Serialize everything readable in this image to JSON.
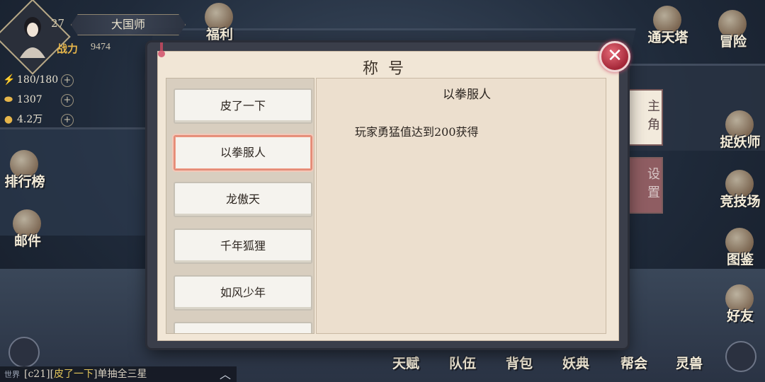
{
  "player": {
    "level": "27",
    "title": "大国师",
    "power_label": "战力",
    "power_value": "9474"
  },
  "stats": [
    {
      "icon": "lightning-icon",
      "value": "180/180"
    },
    {
      "icon": "ingot-icon",
      "value": "1307"
    },
    {
      "icon": "coin-icon",
      "value": "4.2万"
    }
  ],
  "top_icons": [
    "福利",
    "通天塔",
    "冒险"
  ],
  "left_icons": [
    "排行榜",
    "邮件"
  ],
  "right_icons": [
    "捉妖师",
    "竞技场",
    "图鉴",
    "好友"
  ],
  "bottom_icons": [
    "天赋",
    "队伍",
    "背包",
    "妖典",
    "帮会",
    "灵兽"
  ],
  "dialog": {
    "title": "称号",
    "tabs": [
      "主角",
      "设置"
    ],
    "titles": [
      "皮了一下",
      "以拳服人",
      "龙傲天",
      "千年狐狸",
      "如风少年",
      ""
    ],
    "selected_index": 1,
    "detail_name": "以拳服人",
    "detail_desc": "玩家勇猛值达到200获得",
    "close_label": "✕"
  },
  "chat": {
    "channel": "世界",
    "message_prefix": "[c21][",
    "user": "皮了一下",
    "message_suffix": "]单抽全三星"
  }
}
